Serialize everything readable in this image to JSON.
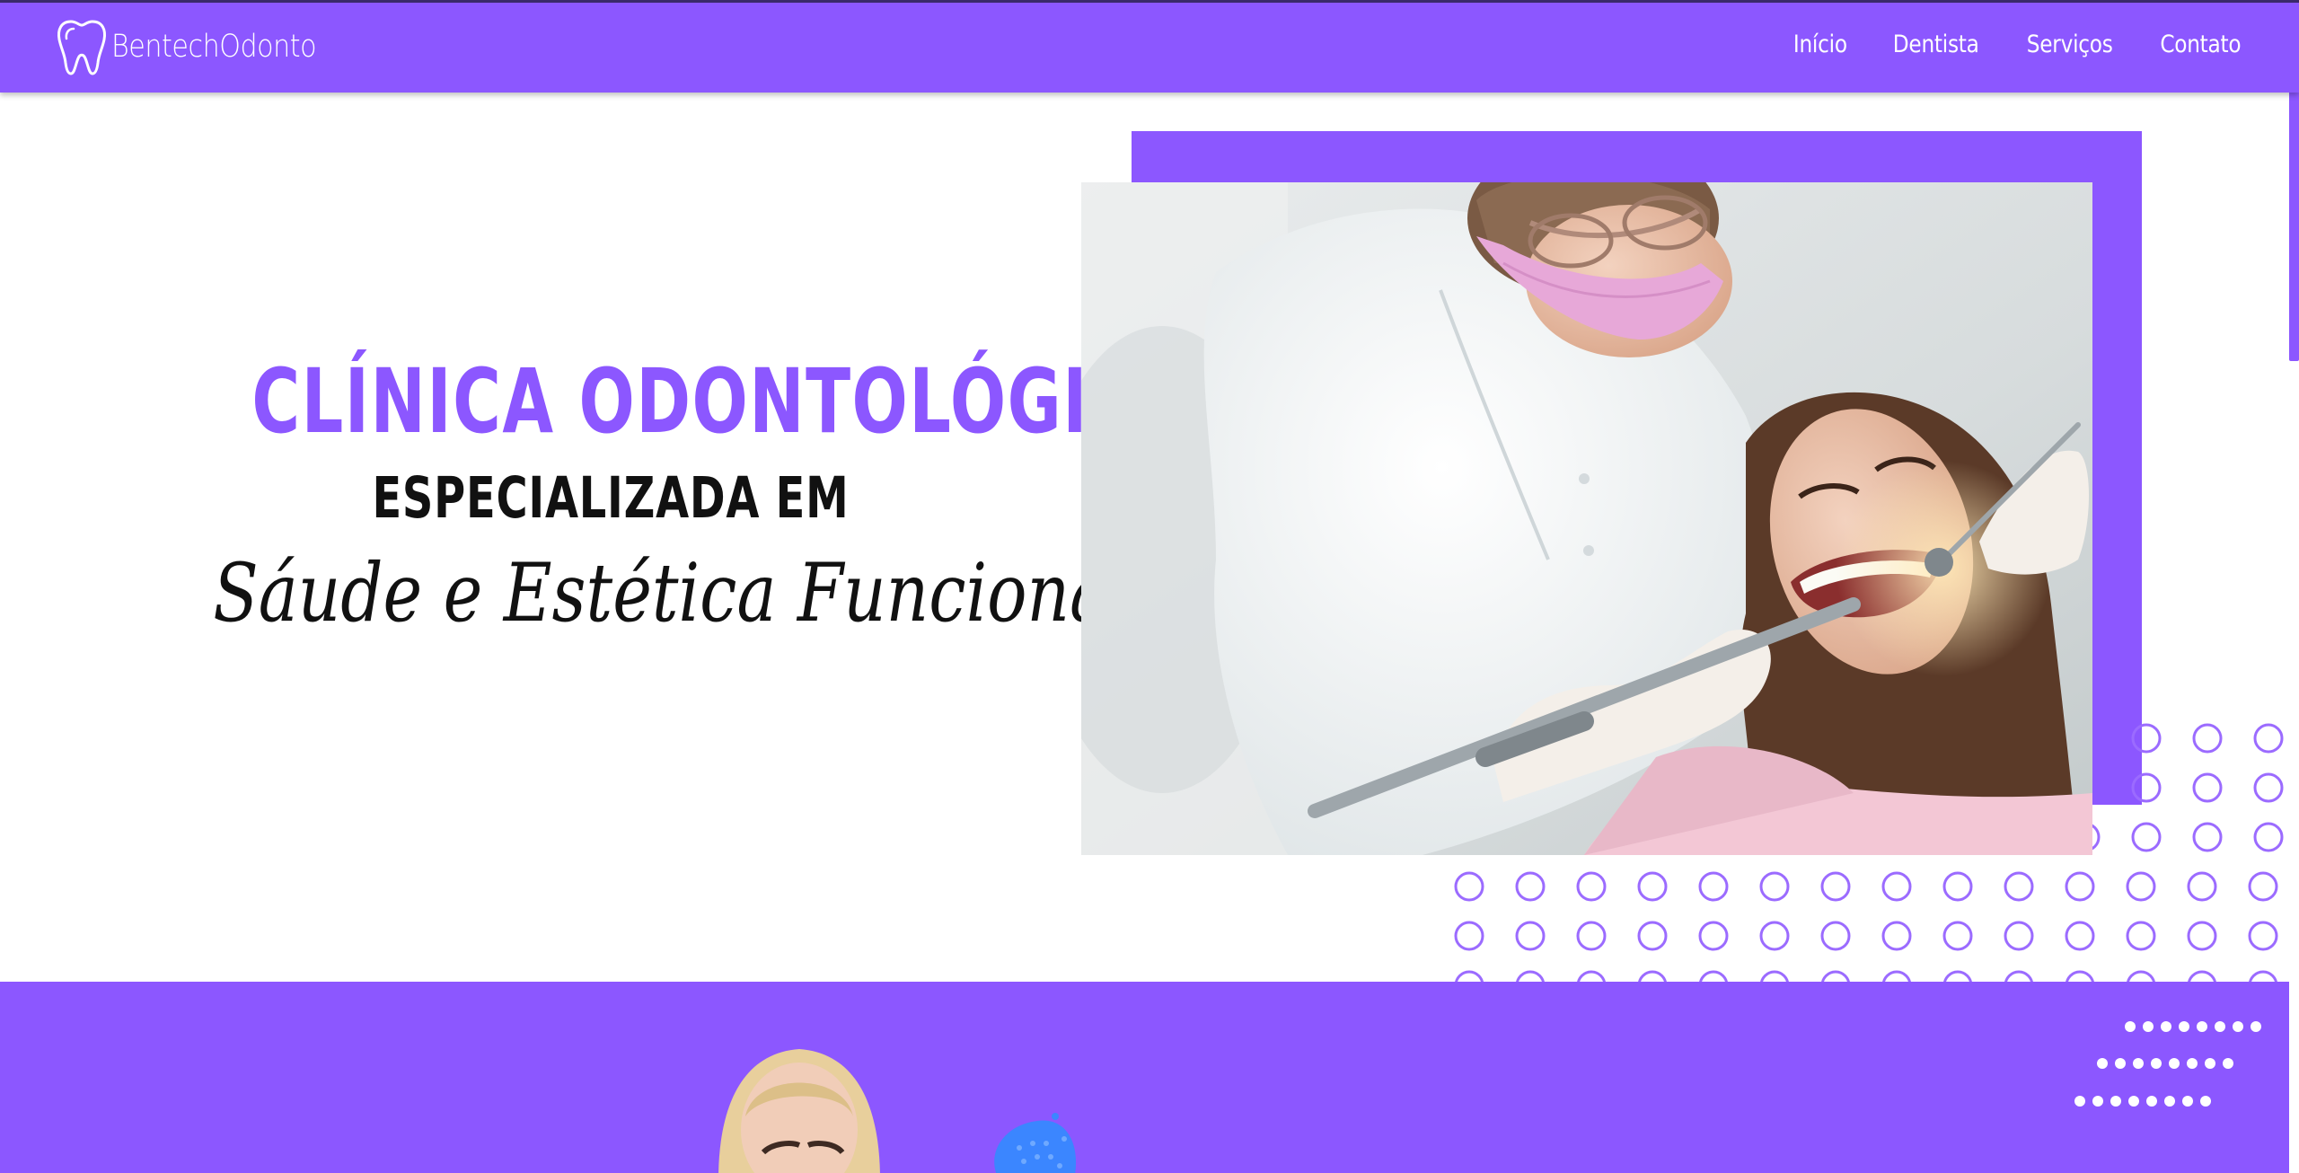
{
  "header": {
    "brand_name": "BentechOdonto",
    "nav": [
      {
        "label": "Início"
      },
      {
        "label": "Dentista"
      },
      {
        "label": "Serviços"
      },
      {
        "label": "Contato"
      }
    ]
  },
  "hero": {
    "title_line1": "CLÍNICA ODONTOLÓGICA",
    "title_line2": "ESPECIALIZADA EM",
    "title_line3": "Sáude e Estética Funcional"
  },
  "colors": {
    "brand_purple": "#8c57ff",
    "text_dark": "#111111",
    "white": "#ffffff"
  },
  "icons": {
    "logo": "tooth-icon"
  }
}
